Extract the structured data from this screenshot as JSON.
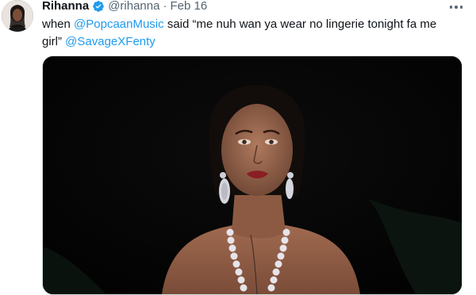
{
  "tweet": {
    "author_name": "Rihanna",
    "handle": "@rihanna",
    "separator": "·",
    "date": "Feb 16",
    "text_parts": {
      "t1": "when ",
      "mention1": "@PopcaanMusic",
      "t2": " said “me nuh wan ya wear no lingerie tonight fa me girl” ",
      "mention2": "@SavageXFenty"
    },
    "icons": {
      "verified": "verified-badge-icon",
      "more": "more-options-icon"
    },
    "colors": {
      "link": "#1d9bf0",
      "verified": "#1d9bf0",
      "secondary_text": "#536471",
      "media_background": "#050505"
    }
  }
}
